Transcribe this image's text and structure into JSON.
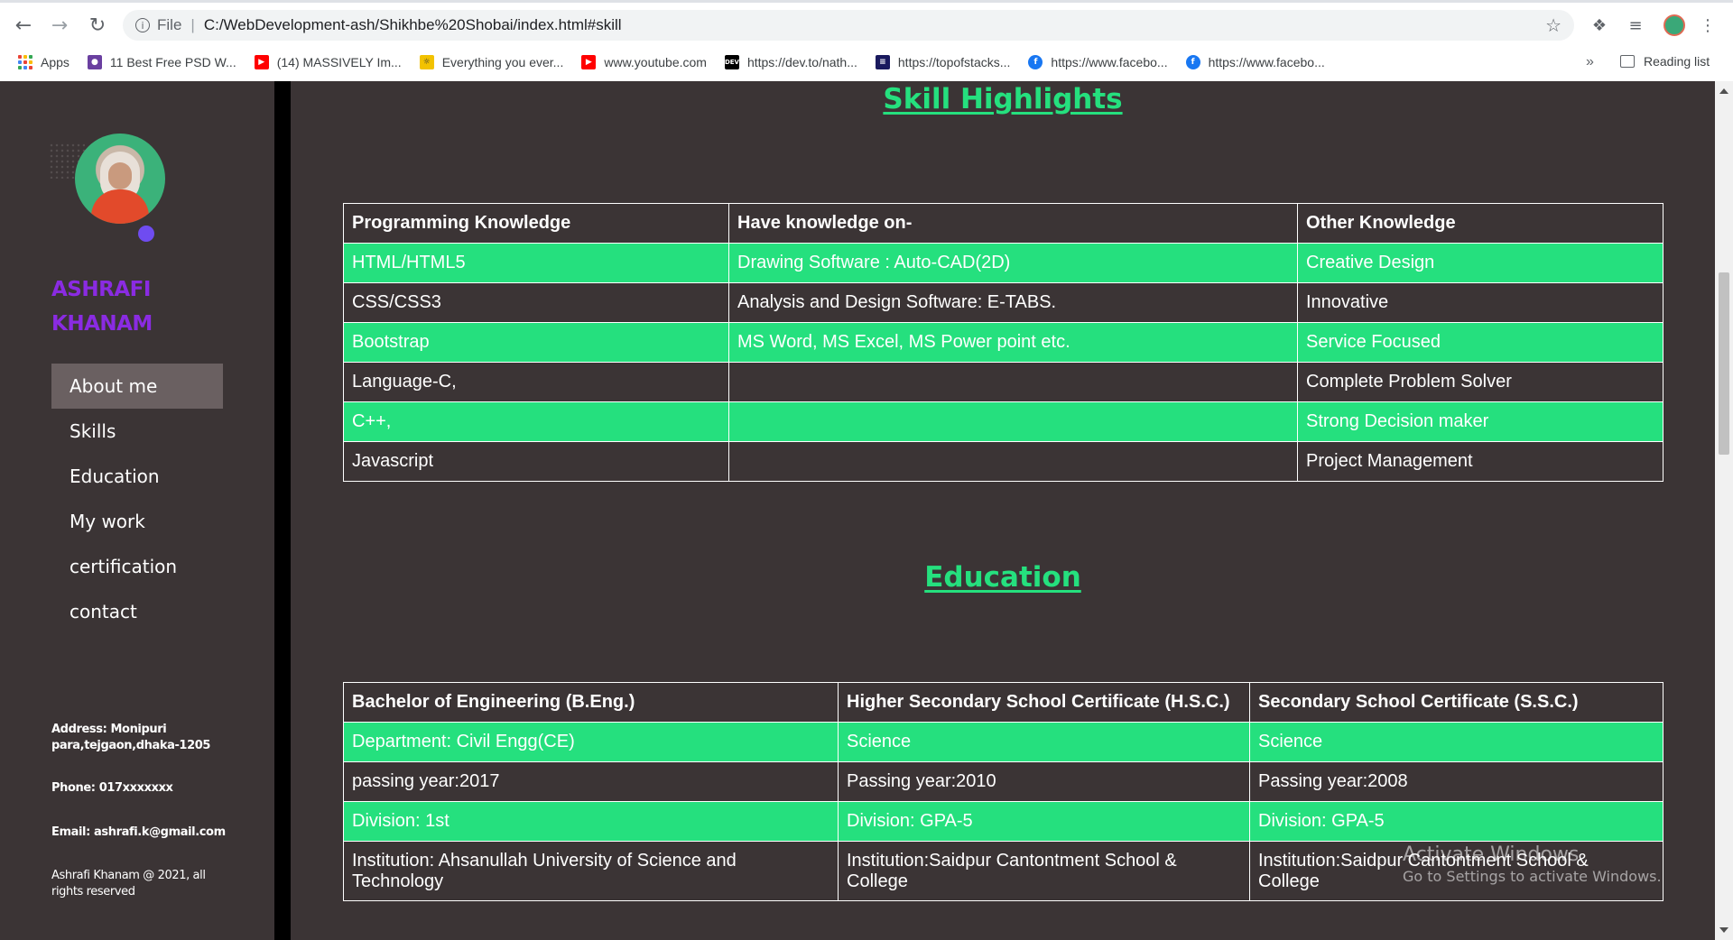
{
  "browser": {
    "url_scheme": "File",
    "url": "C:/WebDevelopment-ash/Shikhbe%20Shobai/index.html#skill",
    "bookmarks": [
      {
        "label": "Apps",
        "icon": "apps-grid-icon"
      },
      {
        "label": "11 Best Free PSD W...",
        "icon": "site-favicon",
        "color": "#6a3fa0"
      },
      {
        "label": "(14) MASSIVELY Im...",
        "icon": "youtube-icon",
        "color": "#ff0000"
      },
      {
        "label": "Everything you ever...",
        "icon": "lightbulb-icon",
        "color": "#f2c200"
      },
      {
        "label": "www.youtube.com",
        "icon": "youtube-icon",
        "color": "#ff0000"
      },
      {
        "label": "https://dev.to/nath...",
        "icon": "dev-icon",
        "color": "#000000"
      },
      {
        "label": "https://topofstacks...",
        "icon": "stack-icon",
        "color": "#1a1a5e"
      },
      {
        "label": "https://www.facebo...",
        "icon": "facebook-icon",
        "color": "#1877f2"
      },
      {
        "label": "https://www.facebo...",
        "icon": "facebook-icon",
        "color": "#1877f2"
      }
    ],
    "more": "»",
    "reading_list": "Reading list"
  },
  "sidebar": {
    "name": "ASHRAFI KHANAM",
    "nav": [
      {
        "label": "About me",
        "active": true
      },
      {
        "label": "Skills",
        "active": false
      },
      {
        "label": "Education",
        "active": false
      },
      {
        "label": "My work",
        "active": false
      },
      {
        "label": "certification",
        "active": false
      },
      {
        "label": "contact",
        "active": false
      }
    ],
    "address": "Address: Monipuri para,tejgaon,dhaka-1205",
    "phone": "Phone: 017xxxxxxx",
    "email": "Email: ashrafi.k@gmail.com",
    "copyright": "Ashrafi Khanam @ 2021, all rights reserved"
  },
  "skills": {
    "title": "Skill Highlights",
    "headers": [
      "Programming Knowledge",
      "Have knowledge on-",
      "Other Knowledge"
    ],
    "rows": [
      [
        "HTML/HTML5",
        "Drawing Software : Auto-CAD(2D)",
        "Creative Design"
      ],
      [
        "CSS/CSS3",
        "Analysis and Design Software: E-TABS.",
        "Innovative"
      ],
      [
        "Bootstrap",
        "MS Word, MS Excel, MS Power point etc.",
        "Service Focused"
      ],
      [
        "Language-C,",
        "",
        "Complete Problem Solver"
      ],
      [
        "C++,",
        "",
        "Strong Decision maker"
      ],
      [
        "Javascript",
        "",
        "Project Management"
      ]
    ]
  },
  "education": {
    "title": "Education",
    "headers": [
      "Bachelor of Engineering (B.Eng.)",
      "Higher Secondary School Certificate (H.S.C.)",
      "Secondary School Certificate (S.S.C.)"
    ],
    "rows": [
      [
        "Department: Civil Engg(CE)",
        "Science",
        "Science"
      ],
      [
        "passing year:2017",
        "Passing year:2010",
        "Passing year:2008"
      ],
      [
        "Division: 1st",
        "Division: GPA-5",
        "Division: GPA-5"
      ],
      [
        "Institution: Ahsanullah University of Science and Technology",
        "Institution:Saidpur Cantontment School & College",
        "Institution:Saidpur Cantontment School & College"
      ]
    ]
  },
  "watermark": {
    "line1": "Activate Windows",
    "line2": "Go to Settings to activate Windows."
  },
  "colors": {
    "accent_green": "#25e07e",
    "name_purple": "#8a2be2",
    "background": "#3b3435"
  }
}
